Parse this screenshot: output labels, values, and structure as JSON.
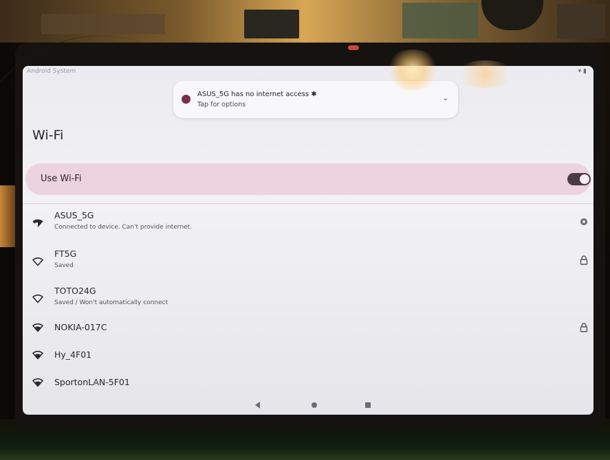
{
  "status_bar": {
    "left_text": "Android System",
    "right_text": "▾ ▮"
  },
  "notification": {
    "title": "ASUS_5G has no internet access ✱",
    "subtitle": "Tap for options",
    "chevron": "⌄"
  },
  "page": {
    "title": "Wi-Fi"
  },
  "use_wifi": {
    "label": "Use Wi-Fi",
    "enabled": true
  },
  "networks": [
    {
      "name": "ASUS_5G",
      "status": "Connected to device. Can't provide internet.",
      "trailing": "gear-icon"
    },
    {
      "name": "FT5G",
      "status": "Saved",
      "trailing": "lock-icon"
    },
    {
      "name": "TOTO24G",
      "status": "Saved / Won't automatically connect",
      "trailing": ""
    },
    {
      "name": "NOKIA-017C",
      "status": "",
      "trailing": "lock-icon"
    },
    {
      "name": "Hy_4F01",
      "status": "",
      "trailing": ""
    },
    {
      "name": "SportonLAN-5F01",
      "status": "",
      "trailing": ""
    }
  ],
  "colors": {
    "accent_row": "#ecd3df",
    "toggle_on": "#4d3b44",
    "notification_icon": "#7a2e4a"
  }
}
